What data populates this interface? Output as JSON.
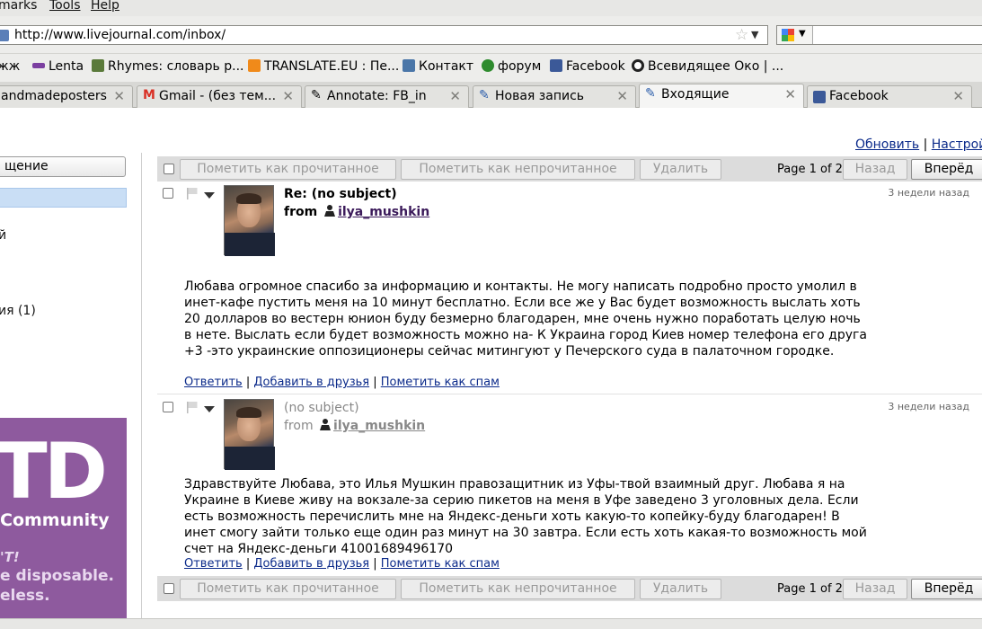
{
  "menu": {
    "bookmarks": "marks",
    "tools": "Tools",
    "help": "Help"
  },
  "urlbar": {
    "url": "http://www.livejournal.com/inbox/"
  },
  "bookmarks": [
    {
      "label": "жж",
      "icon": "none"
    },
    {
      "label": "Lenta",
      "icon": "lenta-icon",
      "color": "#7b3fa0"
    },
    {
      "label": "Rhymes: словарь р...",
      "icon": "rhymes-icon",
      "color": "#5a7a3a"
    },
    {
      "label": "TRANSLATE.EU : Пе...",
      "icon": "translate-icon",
      "color": "#f08a1a"
    },
    {
      "label": "Контакт",
      "icon": "vk-icon",
      "color": "#4a76a8"
    },
    {
      "label": "форум",
      "icon": "forum-icon",
      "color": "#2e8b2e"
    },
    {
      "label": "Facebook",
      "icon": "facebook-icon",
      "color": "#3b5998"
    },
    {
      "label": "Всевидящее Око | ...",
      "icon": "eye-icon",
      "color": "#222222"
    }
  ],
  "tabs": [
    {
      "label": "andmadeposters"
    },
    {
      "label": "Gmail - (без тем..."
    },
    {
      "label": "Annotate: FB_in"
    },
    {
      "label": "Новая запись"
    },
    {
      "label": "Входящие"
    },
    {
      "label": "Facebook"
    }
  ],
  "sidebar": {
    "compose": "щение",
    "items": [
      "й",
      "ия (1)"
    ],
    "promo": {
      "big": "TD",
      "community": "Community",
      "line1": "'T!",
      "line2": "e disposable.",
      "line3": "eless."
    }
  },
  "toplinks": {
    "refresh": "Обновить",
    "separator": "|",
    "settings": "Настройк"
  },
  "toolbar": {
    "mark_read": "Пометить как прочитанное",
    "mark_unread": "Пометить как непрочитанное",
    "delete": "Удалить",
    "page_info": "Page 1 of 2",
    "prev": "Назад",
    "next": "Вперёд"
  },
  "messages": [
    {
      "subject": "Re: (no subject)",
      "from_prefix": "from",
      "sender": "ilya_mushkin",
      "ago": "3 недели назад",
      "body": "Любава огромное спасибо за информацию и контакты. Не могу написать подробно просто умолил в инет-кафе пустить меня на 10 минут бесплатно. Если все же у Вас будет возможность выслать хоть 20 долларов во вестерн юнион буду безмерно благодарен, мне очень нужно поработать целую ночь в нете. Выслать если будет возможность можно на- К                                             Украина город Киев номер телефона его друга +3                        -это украинские оппозиционеры сейчас митингуют у Печерского суда в палаточном городке.",
      "reply": "Ответить",
      "add_friend": "Добавить в друзья",
      "spam": "Пометить как спам"
    },
    {
      "subject": "(no subject)",
      "from_prefix": "from",
      "sender": "ilya_mushkin",
      "ago": "3 недели назад",
      "body": "Здравствуйте Любава, это Илья Мушкин правозащитник из Уфы-твой взаимный друг. Любава я на Украине в Киеве живу на вокзале-за серию пикетов на меня в Уфе заведено 3 уголовных дела. Если есть возможность перечислить мне на Яндекс-деньги хоть какую-то копейку-буду благодарен! В инет смогу зайти только еще один раз минут на 30 завтра. Если есть хоть какая-то возможность мой счет на Яндекс-деньги 41001689496170",
      "reply": "Ответить",
      "add_friend": "Добавить в друзья",
      "spam": "Пометить как спам"
    }
  ]
}
